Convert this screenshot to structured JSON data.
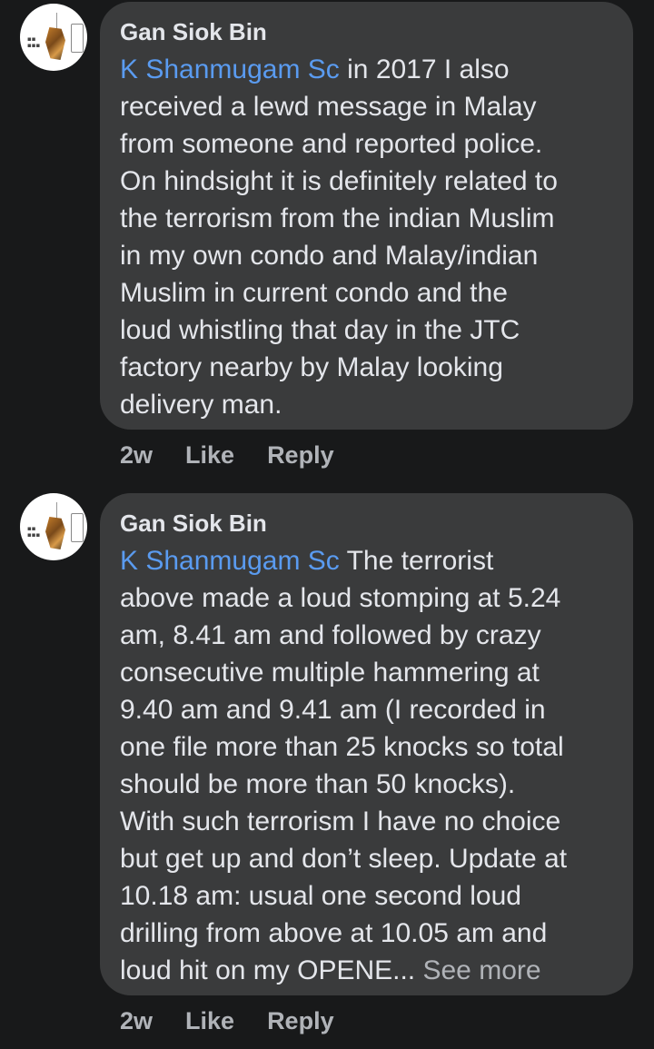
{
  "comments": [
    {
      "author": "Gan Siok Bin",
      "mention": "K Shanmugam Sc",
      "text": " in 2017 I also\nreceived a lewd message in Malay\nfrom someone and reported police.\nOn hindsight it is definitely related to\nthe terrorism from the indian Muslim\nin my own condo and Malay/indian\nMuslim in current condo and the\nloud whistling that day in the JTC\nfactory nearby by Malay looking\ndelivery man.",
      "see_more": "",
      "time": "2w",
      "like_label": "Like",
      "reply_label": "Reply"
    },
    {
      "author": "Gan Siok Bin",
      "mention": "K Shanmugam Sc",
      "text": " The terrorist\nabove made a loud stomping at 5.24\nam, 8.41 am and followed by crazy\nconsecutive multiple hammering at\n9.40 am and 9.41 am (I recorded in\none file more than 25 knocks so total\nshould be more than 50 knocks).\nWith such terrorism I have no choice\nbut get up and don’t sleep. Update at\n10.18 am: usual one second loud\ndrilling from above at 10.05 am and\nloud hit on my OPENE... ",
      "see_more": "See more",
      "time": "2w",
      "like_label": "Like",
      "reply_label": "Reply"
    }
  ]
}
